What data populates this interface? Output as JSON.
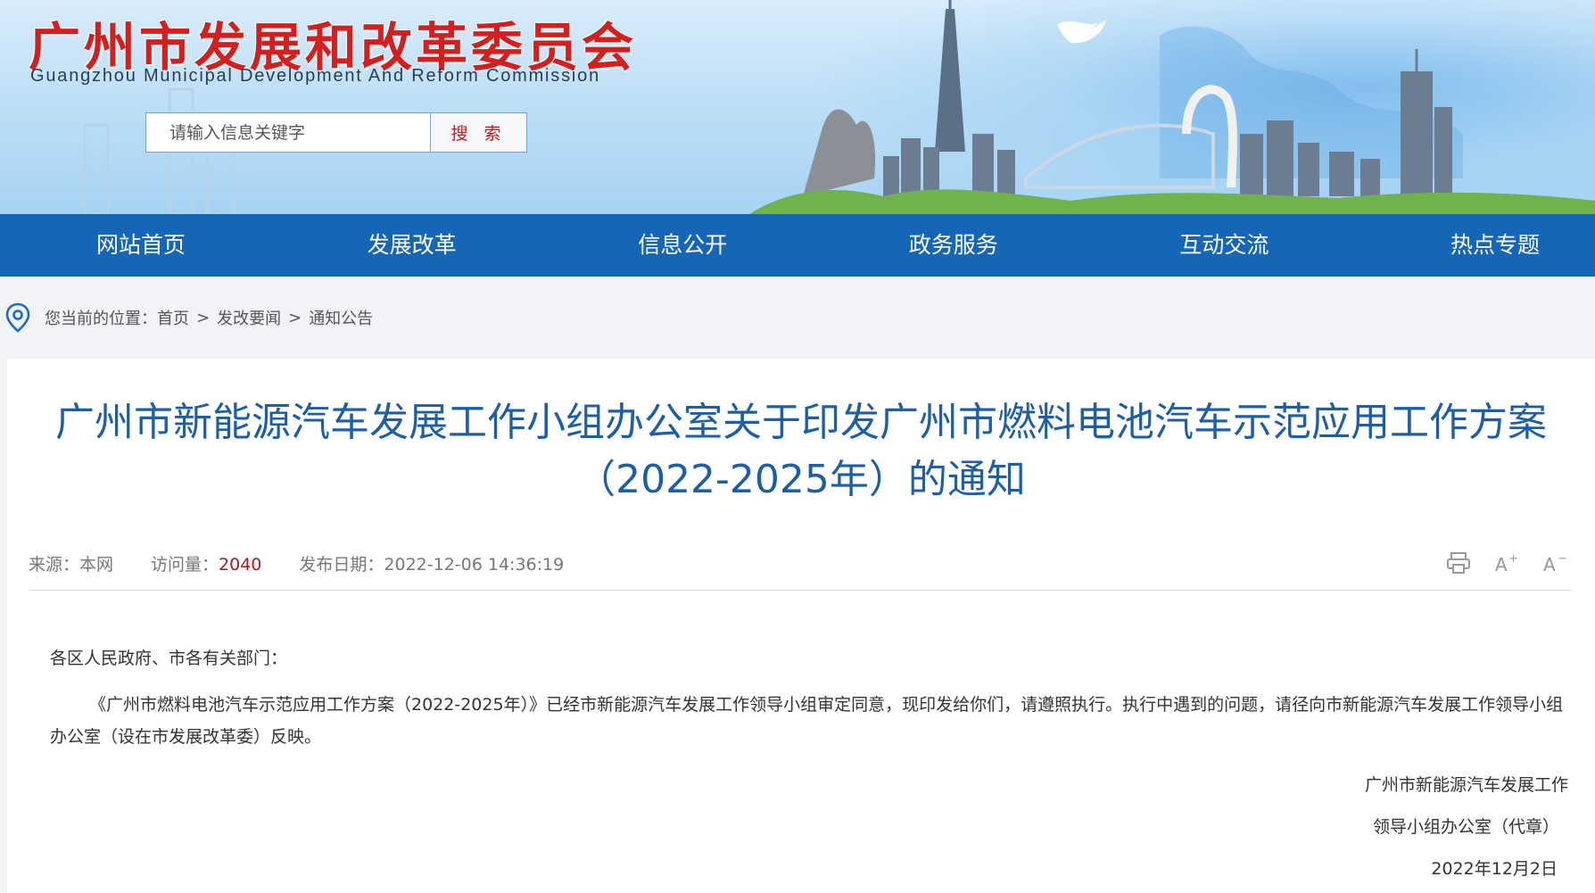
{
  "header": {
    "title": "广州市发展和改革委员会",
    "subtitle": "Guangzhou Municipal Development And Reform Commission",
    "search_placeholder": "请输入信息关键字",
    "search_button": "搜 索"
  },
  "nav": {
    "items": [
      "网站首页",
      "发展改革",
      "信息公开",
      "政务服务",
      "互动交流",
      "热点专题"
    ]
  },
  "breadcrumb": {
    "prefix": "您当前的位置：",
    "items": [
      "首页",
      "发改要闻",
      "通知公告"
    ],
    "separator": ">"
  },
  "article": {
    "title_line1": "广州市新能源汽车发展工作小组办公室关于印发广州市燃料电池汽车示范应用工作方案",
    "title_line2": "（2022-2025年）的通知",
    "meta": {
      "source_label": "来源：",
      "source": "本网",
      "views_label": "访问量：",
      "views": "2040",
      "date_label": "发布日期：",
      "date": "2022-12-06 14:36:19"
    },
    "greeting": "各区人民政府、市各有关部门：",
    "paragraph": "《广州市燃料电池汽车示范应用工作方案（2022-2025年）》已经市新能源汽车发展工作领导小组审定同意，现印发给你们，请遵照执行。执行中遇到的问题，请径向市新能源汽车发展工作领导小组办公室（设在市发展改革委）反映。",
    "signature_line1": "广州市新能源汽车发展工作",
    "signature_line2": "领导小组办公室（代章）",
    "signature_date": "2022年12月2日"
  },
  "colors": {
    "nav_bg": "#1666b8",
    "title_blue": "#1c5fa8",
    "brand_red": "#d51e1e"
  }
}
